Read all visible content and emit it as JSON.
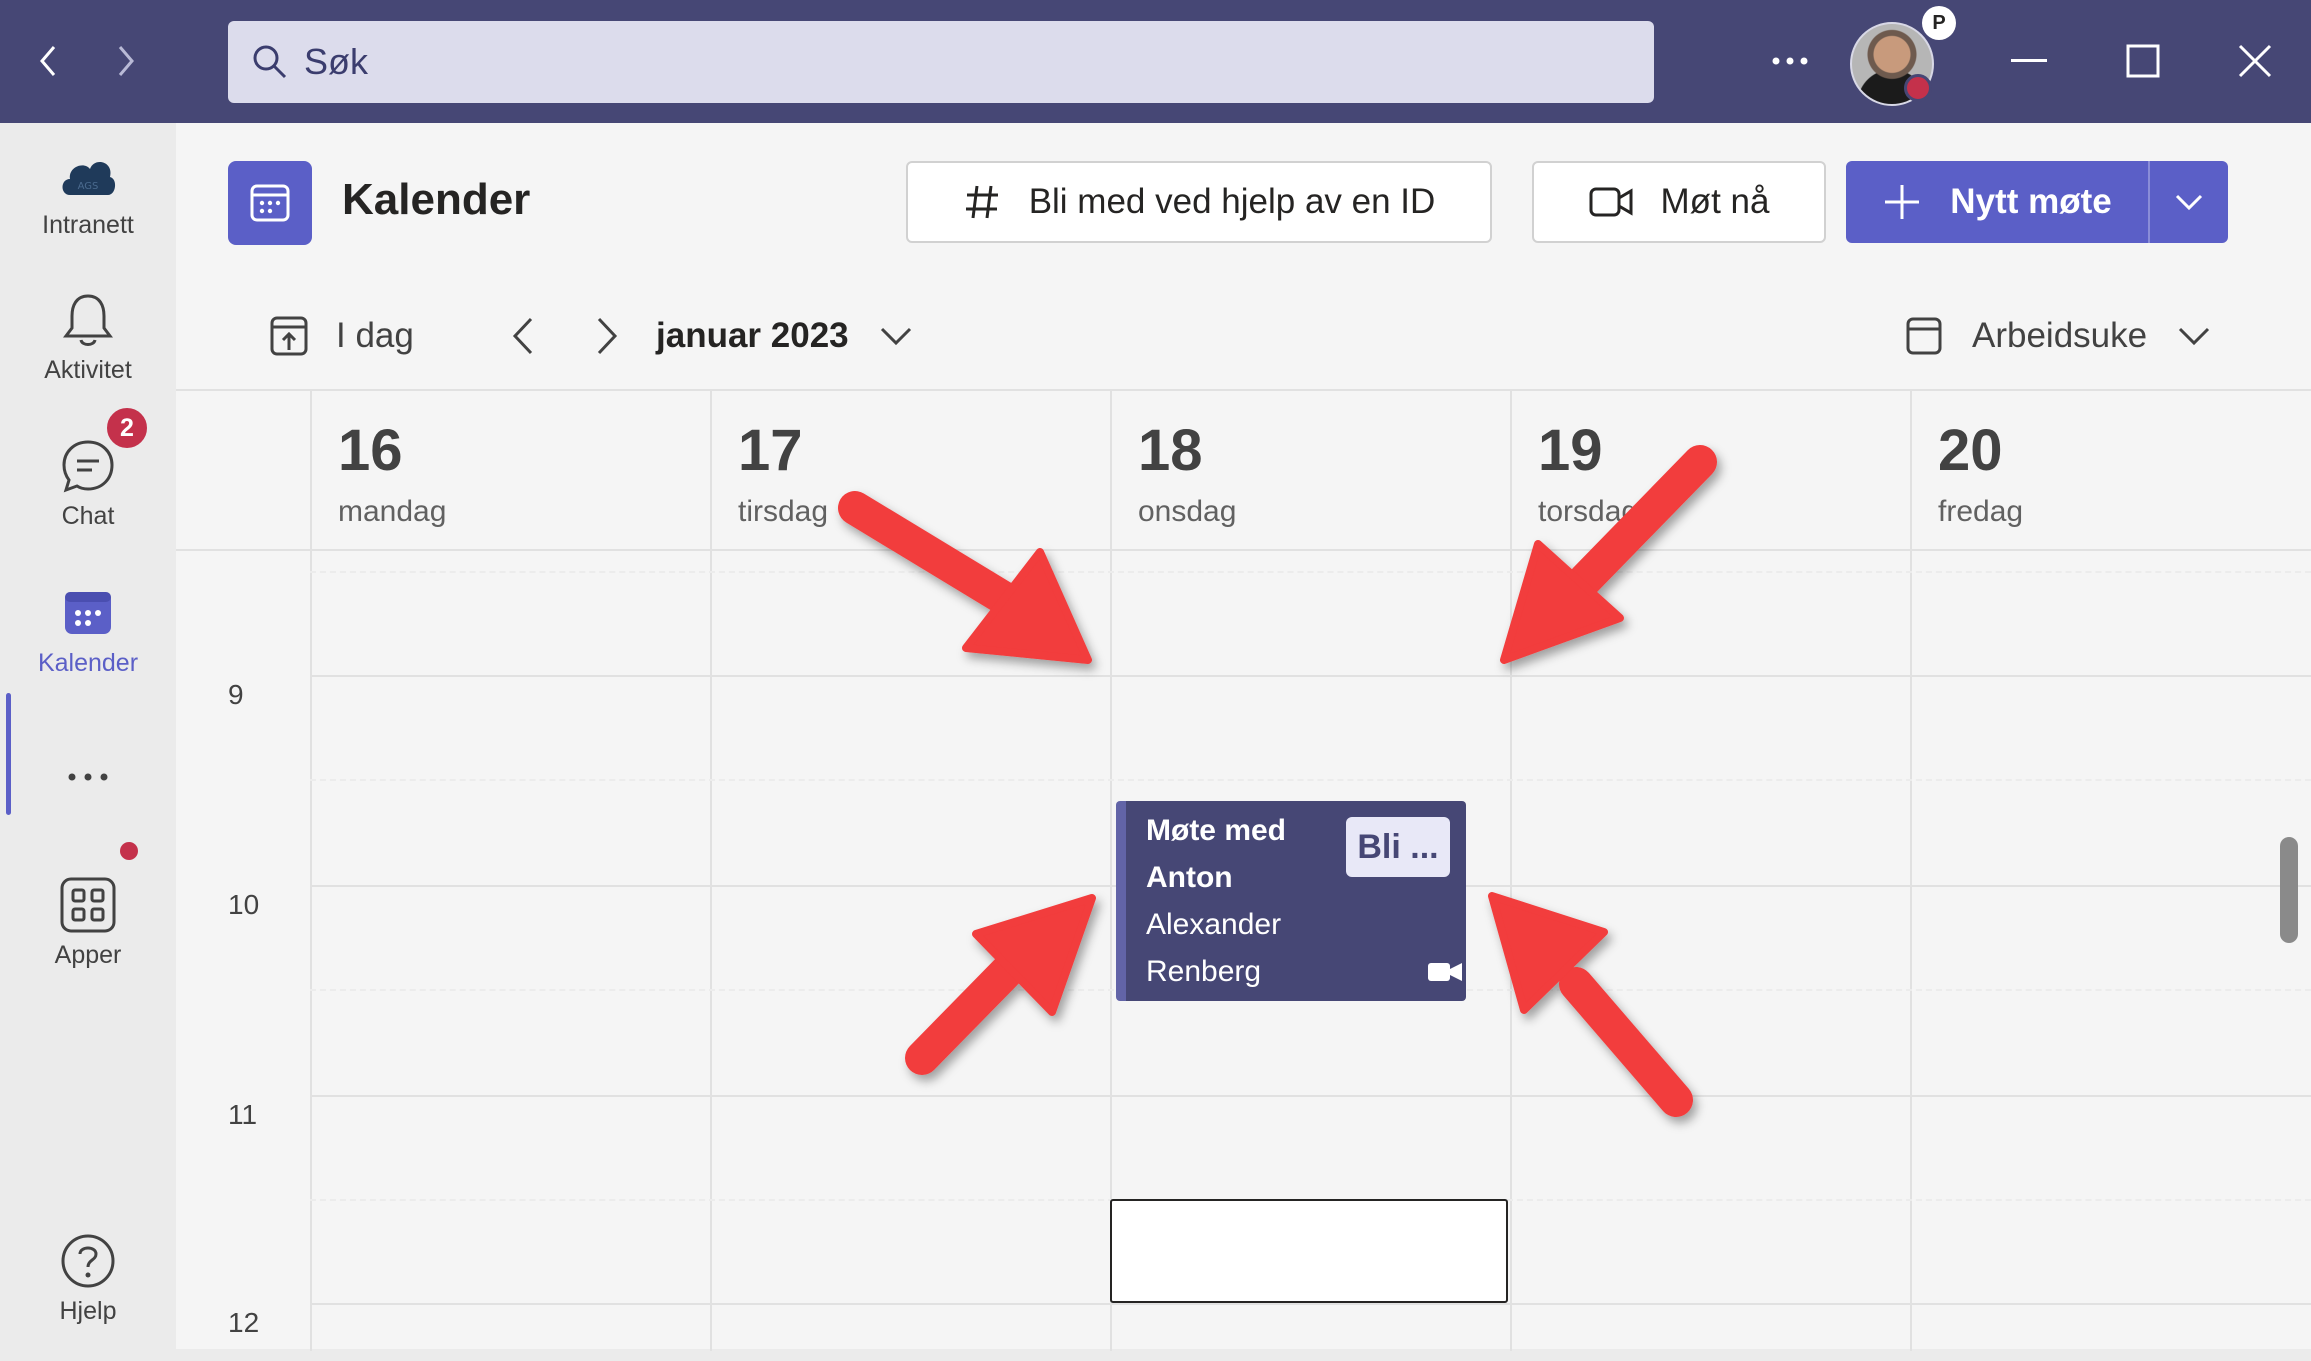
{
  "titlebar": {
    "search_placeholder": "Søk",
    "profile_badge": "P"
  },
  "rail": {
    "items": [
      {
        "label": "Intranett",
        "icon": "intranet-cloud-icon"
      },
      {
        "label": "Aktivitet",
        "icon": "bell-icon",
        "badge": "2"
      },
      {
        "label": "Chat",
        "icon": "chat-icon"
      },
      {
        "label": "Kalender",
        "icon": "calendar-icon",
        "active": true
      },
      {
        "label": "Apper",
        "icon": "apps-grid-icon"
      },
      {
        "label": "Hjelp",
        "icon": "help-icon"
      }
    ],
    "intranet_logo_text": "AGS"
  },
  "header": {
    "title": "Kalender",
    "join_id_label": "Bli med ved hjelp av en ID",
    "meet_now_label": "Møt nå",
    "new_meeting_label": "Nytt møte"
  },
  "toolbar": {
    "today_label": "I dag",
    "month_label": "januar 2023",
    "view_label": "Arbeidsuke"
  },
  "days": [
    {
      "num": "16",
      "name": "mandag"
    },
    {
      "num": "17",
      "name": "tirsdag"
    },
    {
      "num": "18",
      "name": "onsdag"
    },
    {
      "num": "19",
      "name": "torsdag"
    },
    {
      "num": "20",
      "name": "fredag"
    }
  ],
  "hours": [
    "9",
    "10",
    "11",
    "12"
  ],
  "event": {
    "title_line1": "Møte med",
    "title_line2": "Anton",
    "organizer_line1": "Alexander",
    "organizer_line2": "Renberg",
    "join_label": "Bli ..."
  },
  "colors": {
    "titlebar": "#464775",
    "brand": "#5b5fc7",
    "event_bg": "#464775",
    "annotation_arrow": "#f23c3c",
    "notification": "#c4314b"
  }
}
